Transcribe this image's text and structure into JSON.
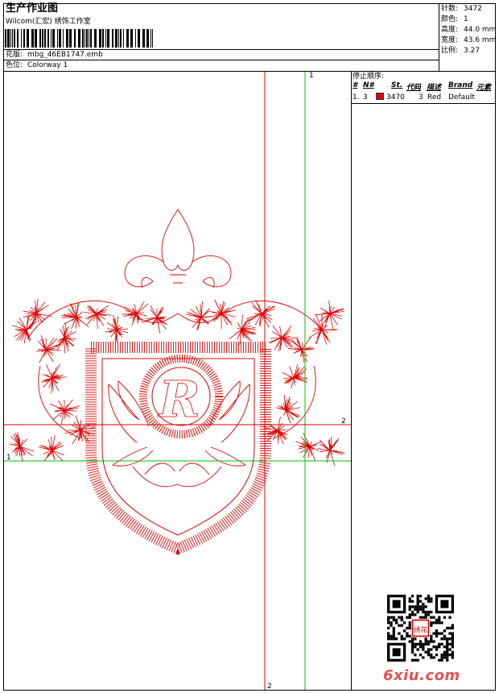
{
  "header": {
    "title": "生产作业图",
    "studio": "Wilcom(汇宏) 绣饰工作室",
    "file_label": "花版:",
    "file_name": "mbg_46EB1747.emb",
    "colorway_label": "色位:",
    "colorway_name": "Colorway 1"
  },
  "stats": {
    "stitches_label": "针数:",
    "stitches_value": "3472",
    "colors_label": "颜色:",
    "colors_value": "1",
    "height_label": "高度:",
    "height_value": "44.0 mm",
    "width_label": "宽度:",
    "width_value": "43.6 mm",
    "ratio_label": "比例:",
    "ratio_value": "3.27"
  },
  "stop_sequence": {
    "title": "停止顺序:",
    "columns": [
      "#",
      "N#",
      "St.",
      "代码",
      "描述",
      "Brand",
      "元素"
    ],
    "rows": [
      {
        "idx": "1.",
        "needle": "3",
        "stitches": "3470",
        "code": "3",
        "desc": "Red",
        "brand": "Default",
        "color": "#e00000"
      }
    ]
  },
  "guides": {
    "v_top": "1",
    "h_right": "2",
    "h_left": "1",
    "v_bottom": "2",
    "colors": {
      "green": "#00c000",
      "red": "#e00000"
    }
  },
  "design": {
    "stitch_color": "#e00000",
    "letter": "R"
  },
  "qr": {
    "stamp_text": "绣花"
  },
  "watermark": "6xiu.com"
}
